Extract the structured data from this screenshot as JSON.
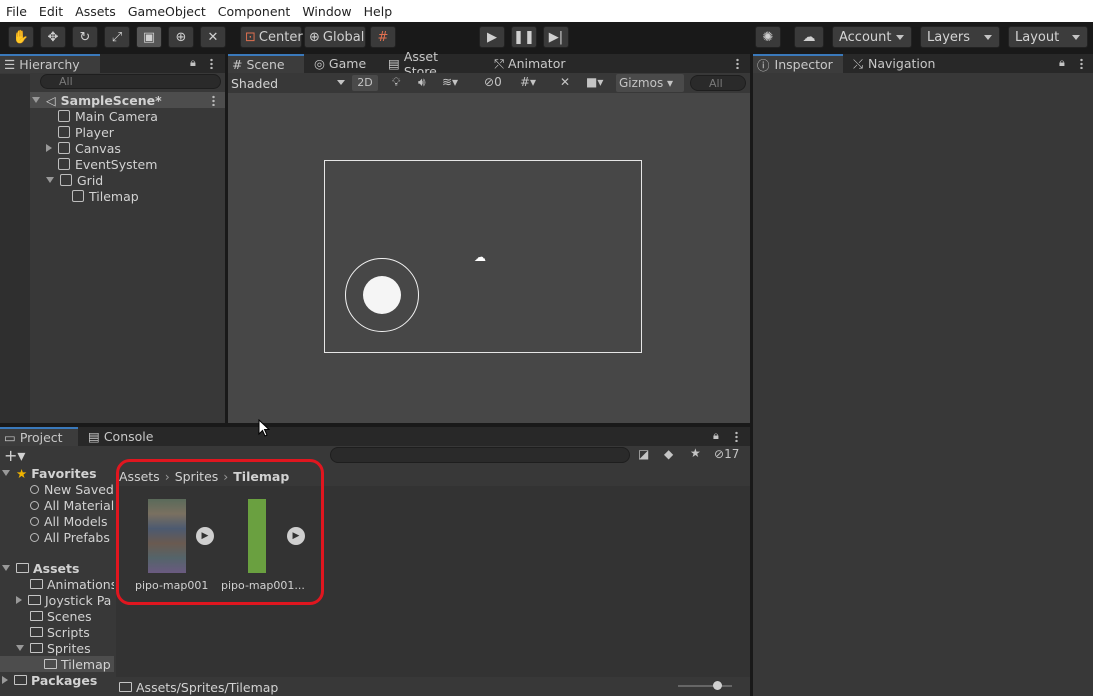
{
  "menu": [
    "File",
    "Edit",
    "Assets",
    "GameObject",
    "Component",
    "Window",
    "Help"
  ],
  "toolbar": {
    "pivot": "Center",
    "space": "Global",
    "account": "Account",
    "layers": "Layers",
    "layout": "Layout"
  },
  "hierarchy": {
    "tab": "Hierarchy",
    "search_placeholder": "All",
    "scene": "SampleScene*",
    "items": [
      "Main Camera",
      "Player",
      "Canvas",
      "EventSystem",
      "Grid",
      "Tilemap"
    ]
  },
  "scene_tabs": [
    "Scene",
    "Game",
    "Asset Store",
    "Animator"
  ],
  "scene_toolbar": {
    "shading": "Shaded",
    "mode_2d": "2D",
    "hidden_count": "0",
    "gizmos": "Gizmos",
    "search_placeholder": "All"
  },
  "inspector_tabs": [
    "Inspector",
    "Navigation"
  ],
  "project": {
    "tabs": [
      "Project",
      "Console"
    ],
    "hidden_count": "17",
    "favorites_label": "Favorites",
    "favorites": [
      "New Saved",
      "All Materials",
      "All Models",
      "All Prefabs"
    ],
    "assets_label": "Assets",
    "folders": [
      "Animations",
      "Joystick Pa",
      "Scenes",
      "Scripts",
      "Sprites",
      "Tilemap"
    ],
    "packages_label": "Packages",
    "breadcrumb": [
      "Assets",
      "Sprites",
      "Tilemap"
    ],
    "items": [
      "pipo-map001",
      "pipo-map001..."
    ],
    "status_path": "Assets/Sprites/Tilemap"
  },
  "colors": {
    "accent": "#3a79bb",
    "highlight": "#e0161f",
    "selected": "#2c5d87"
  }
}
